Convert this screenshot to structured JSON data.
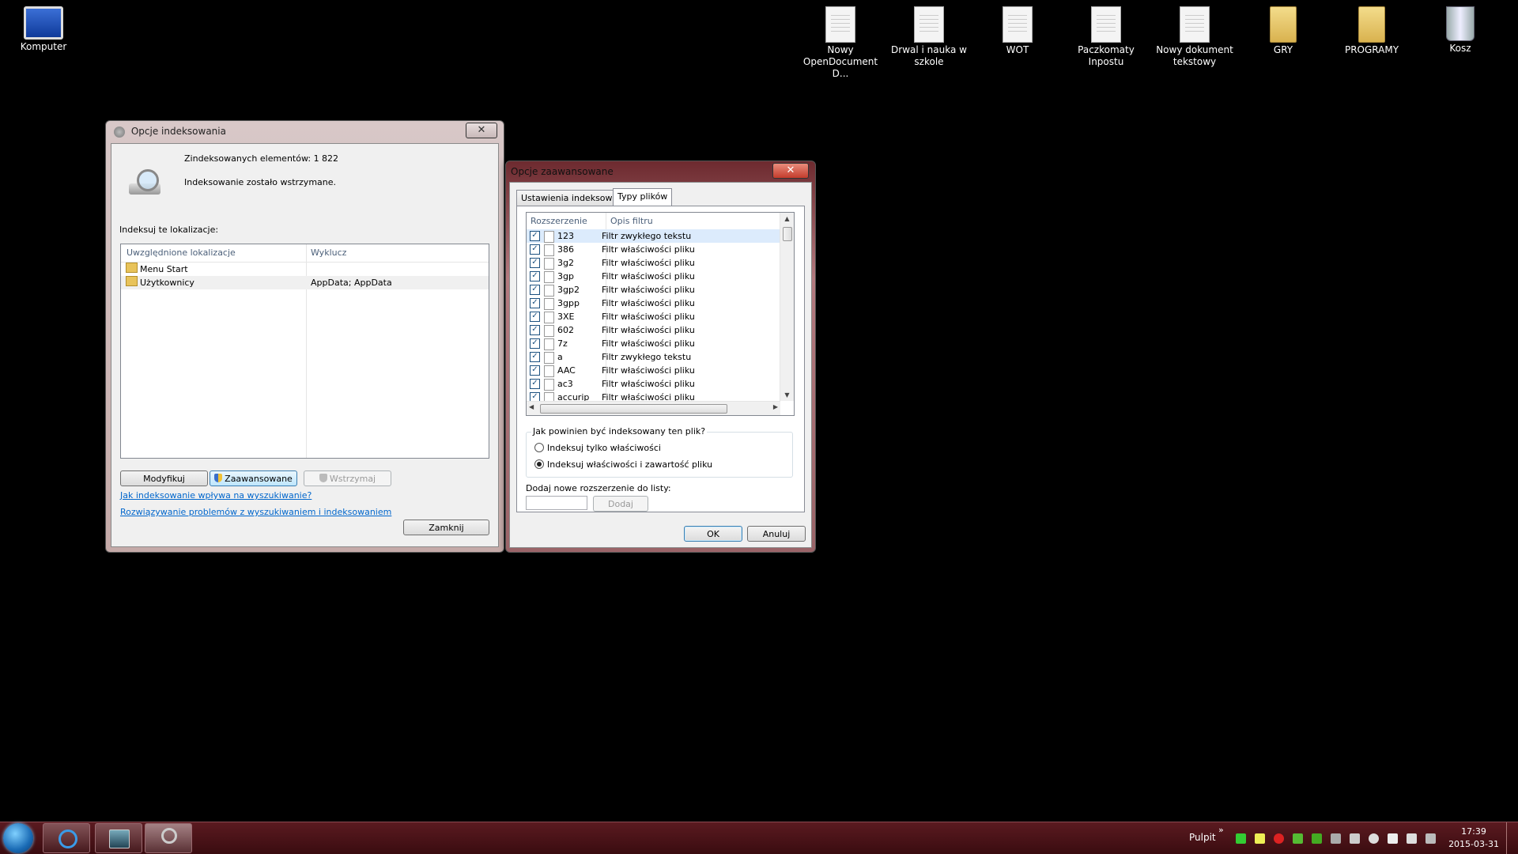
{
  "desktop": {
    "icons": [
      {
        "label": "Komputer"
      },
      {
        "label": "Nowy OpenDocument D..."
      },
      {
        "label": "Drwal i nauka w szkole"
      },
      {
        "label": "WOT"
      },
      {
        "label": "Paczkomaty Inpostu"
      },
      {
        "label": "Nowy dokument tekstowy"
      },
      {
        "label": "GRY"
      },
      {
        "label": "PROGRAMY"
      },
      {
        "label": "Kosz"
      }
    ]
  },
  "indexing_window": {
    "title": "Opcje indeksowania",
    "close": "✕",
    "indexed_count": "Zindeksowanych elementów: 1 822",
    "status": "Indeksowanie zostało wstrzymane.",
    "locations_label": "Indeksuj te lokalizacje:",
    "columns": [
      "Uwzględnione lokalizacje",
      "Wyklucz"
    ],
    "rows": [
      {
        "location": "Menu Start",
        "exclude": ""
      },
      {
        "location": "Użytkownicy",
        "exclude": "AppData; AppData"
      }
    ],
    "btn_modify": "Modyfikuj",
    "btn_advanced": "Zaawansowane",
    "btn_pause": "Wstrzymaj",
    "link1": "Jak indeksowanie wpływa na wyszukiwanie?",
    "link2": "Rozwiązywanie problemów z wyszukiwaniem i indeksowaniem",
    "btn_close": "Zamknij"
  },
  "advanced_window": {
    "title": "Opcje zaawansowane",
    "close": "✕",
    "tabs": [
      "Ustawienia indeksowania",
      "Typy plików"
    ],
    "columns": [
      "Rozszerzenie",
      "Opis filtru"
    ],
    "filetypes": [
      {
        "ext": "123",
        "desc": "Filtr zwykłego tekstu",
        "checked": true
      },
      {
        "ext": "386",
        "desc": "Filtr właściwości pliku",
        "checked": true
      },
      {
        "ext": "3g2",
        "desc": "Filtr właściwości pliku",
        "checked": true
      },
      {
        "ext": "3gp",
        "desc": "Filtr właściwości pliku",
        "checked": true
      },
      {
        "ext": "3gp2",
        "desc": "Filtr właściwości pliku",
        "checked": true
      },
      {
        "ext": "3gpp",
        "desc": "Filtr właściwości pliku",
        "checked": true
      },
      {
        "ext": "3XE",
        "desc": "Filtr właściwości pliku",
        "checked": true
      },
      {
        "ext": "602",
        "desc": "Filtr właściwości pliku",
        "checked": true
      },
      {
        "ext": "7z",
        "desc": "Filtr właściwości pliku",
        "checked": true
      },
      {
        "ext": "a",
        "desc": "Filtr zwykłego tekstu",
        "checked": true
      },
      {
        "ext": "AAC",
        "desc": "Filtr właściwości pliku",
        "checked": true
      },
      {
        "ext": "ac3",
        "desc": "Filtr właściwości pliku",
        "checked": true
      },
      {
        "ext": "accurip",
        "desc": "Filtr właściwości pliku",
        "checked": true
      }
    ],
    "group_label": "Jak powinien być indeksowany ten plik?",
    "radio1": "Indeksuj tylko właściwości",
    "radio2": "Indeksuj właściwości i zawartość pliku",
    "radio_selected": 2,
    "add_label": "Dodaj nowe rozszerzenie do listy:",
    "add_value": "",
    "btn_add": "Dodaj",
    "btn_ok": "OK",
    "btn_cancel": "Anuluj"
  },
  "taskbar": {
    "desktop_label": "Pulpit",
    "chevron": "»",
    "time": "17:39",
    "date": "2015-03-31"
  }
}
